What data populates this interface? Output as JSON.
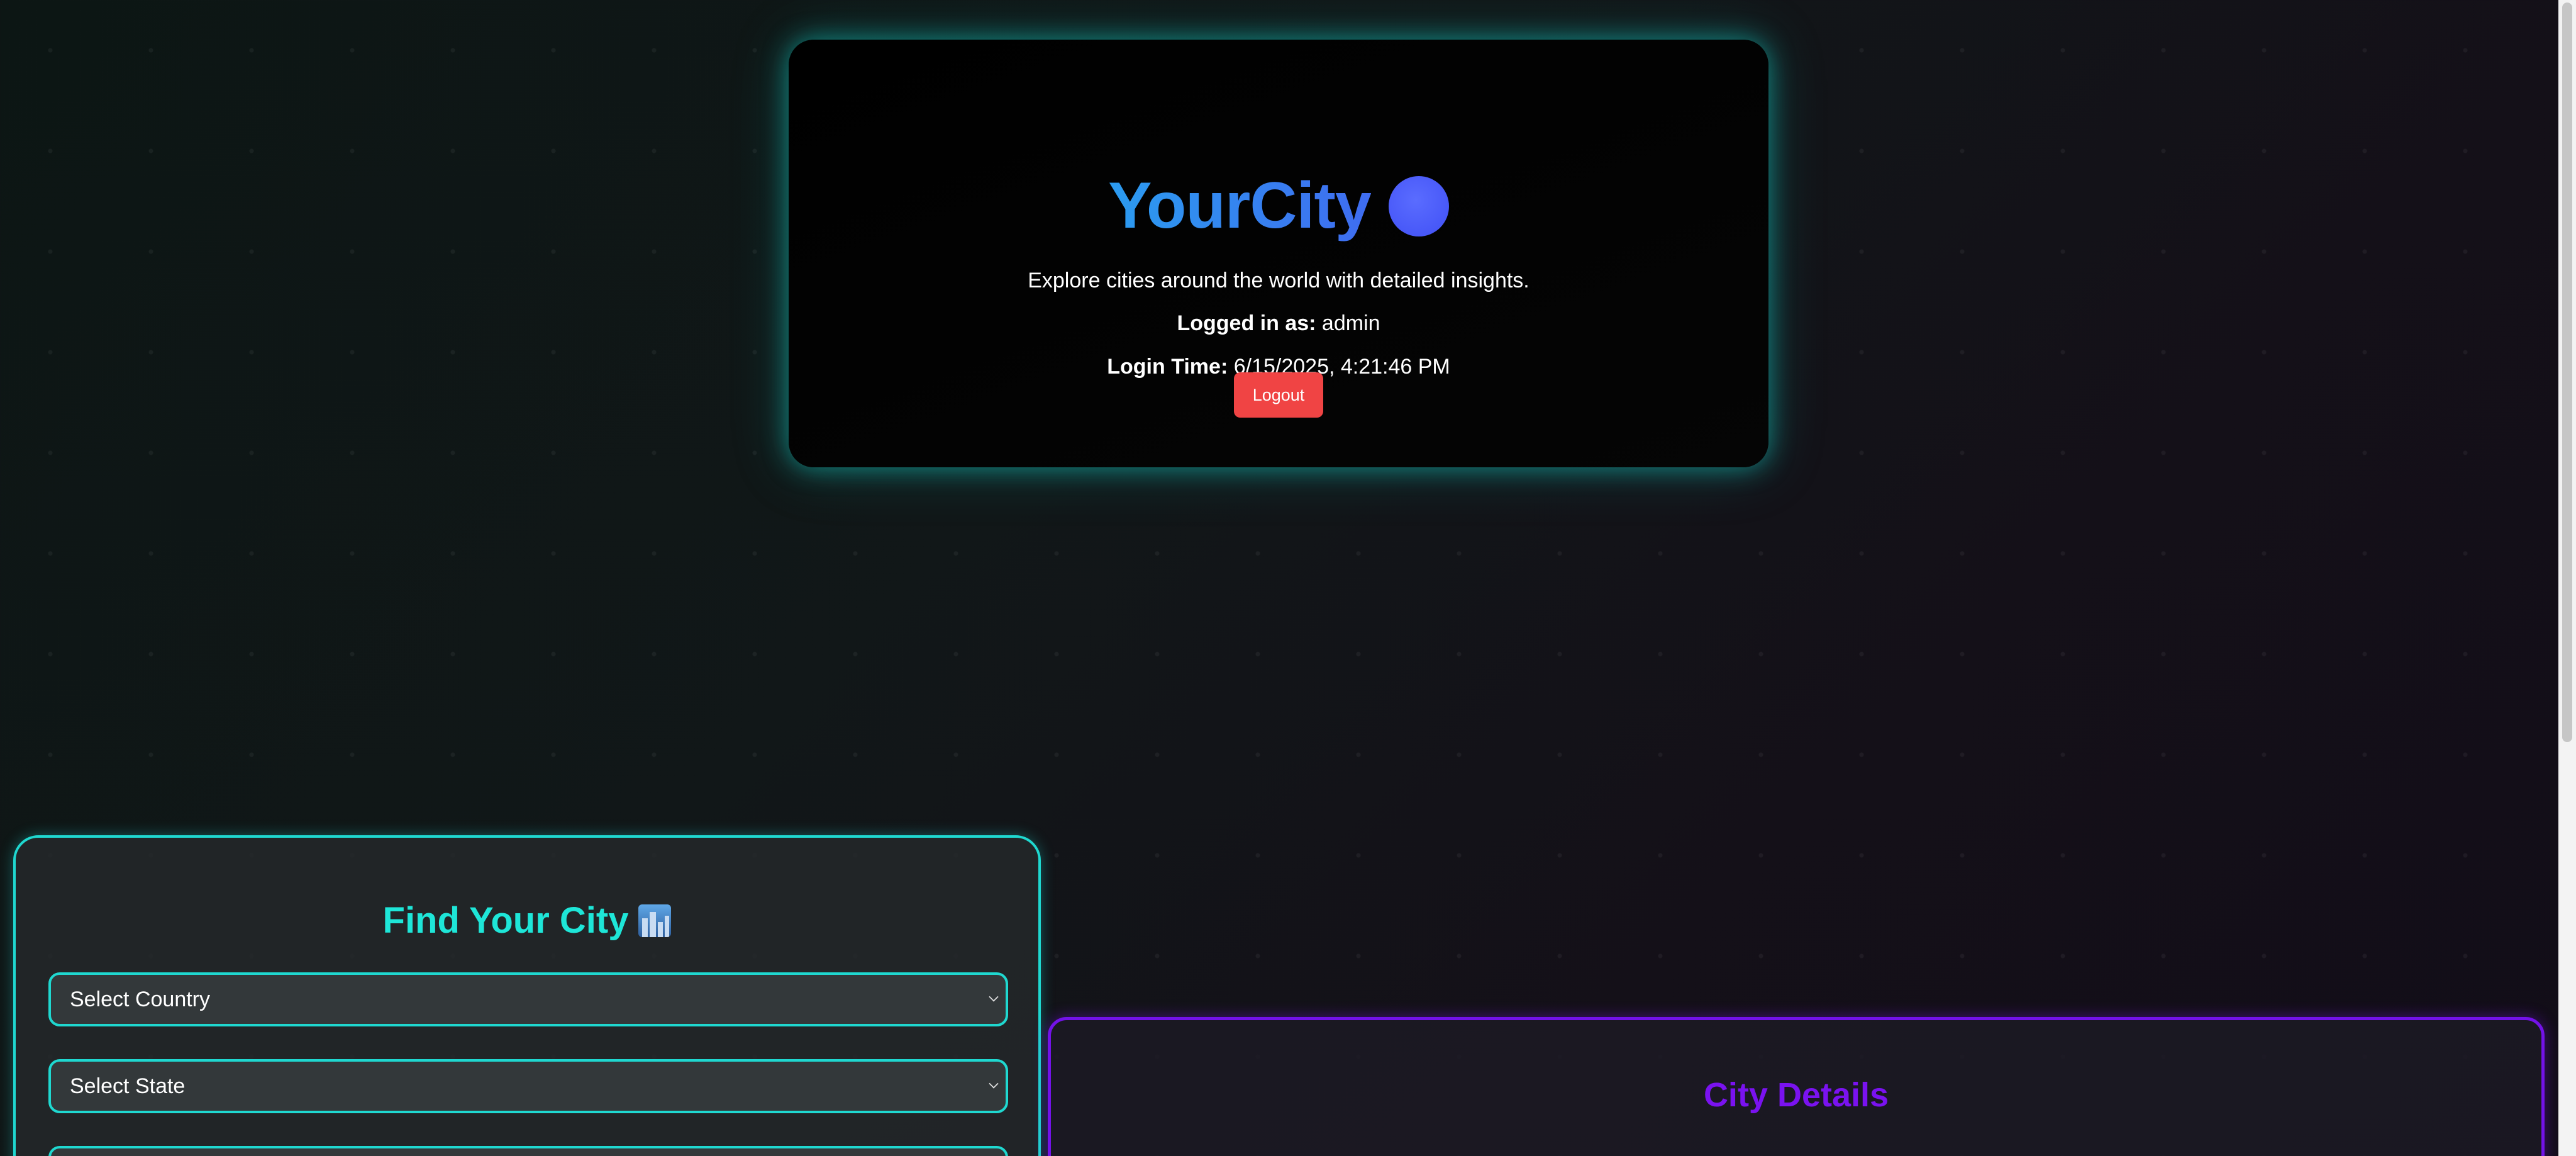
{
  "header": {
    "title": "YourCity",
    "globe_icon": "globe-icon",
    "subtitle": "Explore cities around the world with detailed insights.",
    "logged_in_label": "Logged in as:",
    "logged_in_value": "admin",
    "login_time_label": "Login Time:",
    "login_time_value": "6/15/2025, 4:21:46 PM",
    "logout_label": "Logout"
  },
  "finder": {
    "title": "Find Your City",
    "title_icon": "cityscape-icon",
    "country_select": "Select Country",
    "state_select": "Select State",
    "city_select": ""
  },
  "details": {
    "title": "City Details"
  },
  "colors": {
    "accent_teal": "#1fd8d0",
    "accent_purple": "#7312e8",
    "title_blue": "#2b9cf0",
    "logout_red": "#f04444"
  }
}
